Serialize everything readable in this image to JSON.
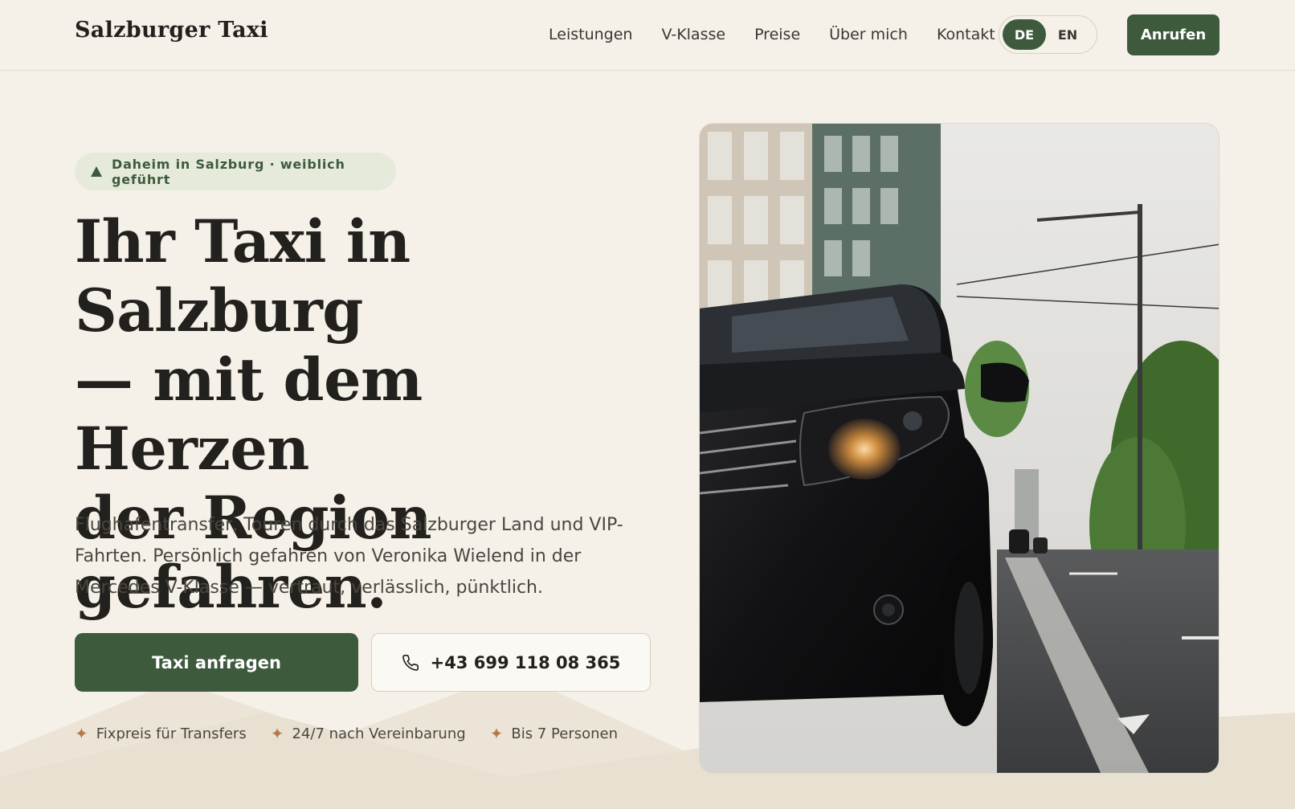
{
  "header": {
    "brand": "Salzburger Taxi",
    "nav": [
      {
        "label": "Leistungen"
      },
      {
        "label": "V-Klasse"
      },
      {
        "label": "Preise"
      },
      {
        "label": "Über mich"
      },
      {
        "label": "Kontakt"
      }
    ],
    "lang": {
      "active": "DE",
      "inactive": "EN"
    },
    "call_label": "Anrufen"
  },
  "hero": {
    "badge": "Daheim in Salzburg · weiblich geführt",
    "headline_lines": [
      "Ihr Taxi in Salzburg",
      "— mit dem Herzen",
      "der Region",
      "gefahren."
    ],
    "lead": "Flughafentransfer, Touren durch das Salzburger Land und VIP-Fahrten. Persönlich gefahren von Veronika Wielend in der Mercedes V-Klasse — vertraut, verlässlich, pünktlich.",
    "primary_cta": "Taxi anfragen",
    "phone_cta": "+43 699 118 08 365",
    "features": [
      "Fixpreis für Transfers",
      "24/7 nach Vereinbarung",
      "Bis 7 Personen"
    ]
  },
  "colors": {
    "accent": "#3e5a3d",
    "background": "#f5f1e9",
    "badge_bg": "#e6eadb",
    "star": "#b9784a"
  },
  "icons": {
    "badge": "mountain-triangle-icon",
    "phone": "phone-icon",
    "feature": "sparkle-star-icon"
  }
}
